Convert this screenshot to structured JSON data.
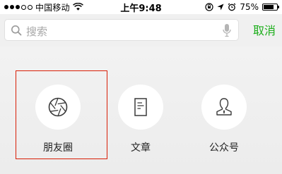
{
  "status_bar": {
    "carrier": "中国移动",
    "time": "上午9:48",
    "battery_percent": "75%",
    "battery_level": 0.75,
    "signal_icon": "signal-dots-icon",
    "wifi_icon": "wifi-icon",
    "lock_icon": "rotation-lock-icon",
    "location_icon": "location-arrow-icon",
    "alarm_icon": "alarm-clock-icon"
  },
  "search": {
    "placeholder": "搜索",
    "cancel_label": "取消",
    "search_icon": "search-icon",
    "voice_icon": "microphone-icon"
  },
  "options": [
    {
      "label": "朋友圈",
      "icon": "aperture-icon",
      "highlighted": true
    },
    {
      "label": "文章",
      "icon": "document-icon",
      "highlighted": false
    },
    {
      "label": "公众号",
      "icon": "person-icon",
      "highlighted": false
    }
  ],
  "colors": {
    "accent": "#1aad19",
    "highlight_border": "#d81e06",
    "background": "#ececec"
  }
}
